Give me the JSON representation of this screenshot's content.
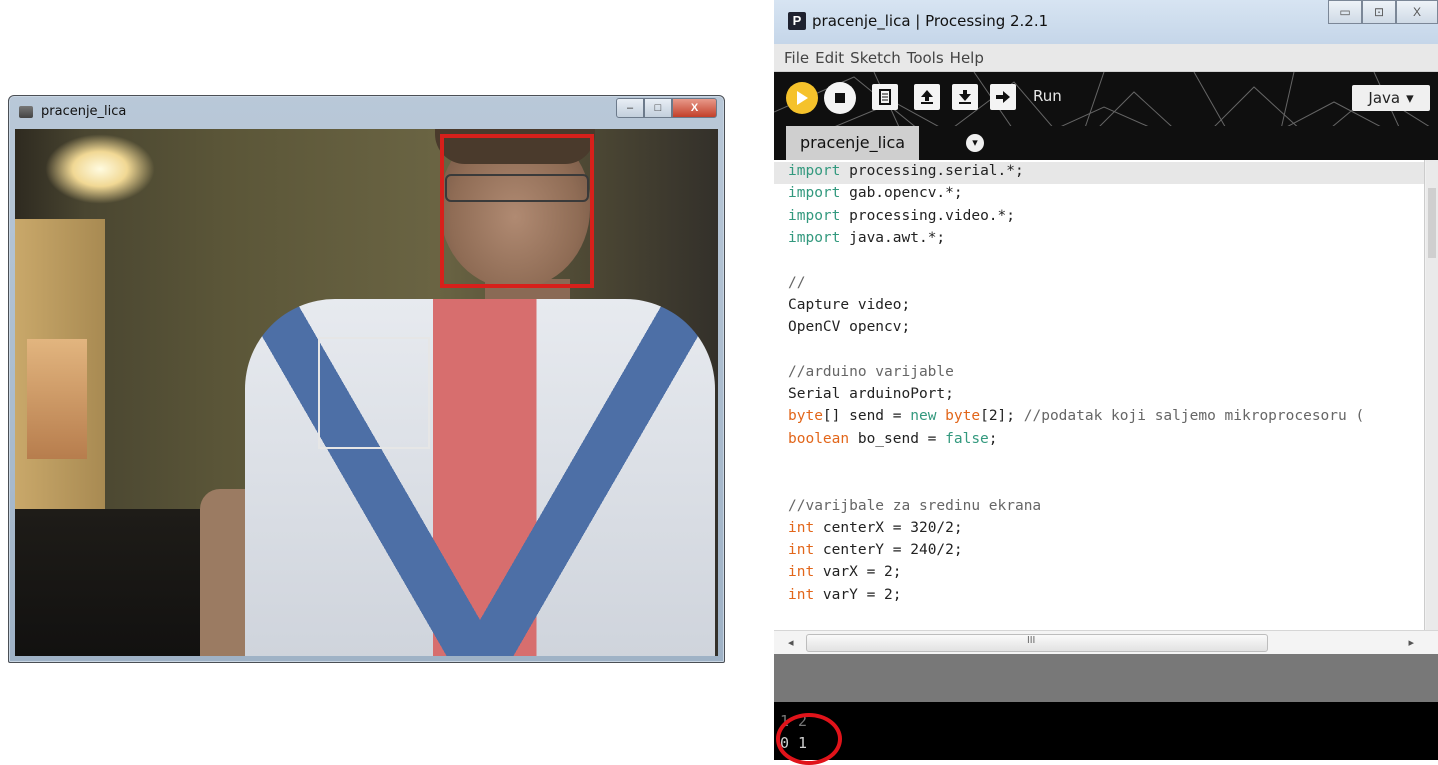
{
  "sketch_window": {
    "title": "pracenje_lica",
    "buttons": [
      "–",
      "□",
      "X"
    ]
  },
  "ide": {
    "title": "pracenje_lica | Processing 2.2.1",
    "logo_letter": "P",
    "window_buttons": [
      "▭",
      "⊡",
      "X"
    ],
    "menu": [
      "File",
      "Edit",
      "Sketch",
      "Tools",
      "Help"
    ],
    "toolbar": {
      "run_label": "Run",
      "mode": "Java"
    },
    "tab": "pracenje_lica",
    "code": [
      [
        {
          "t": "import",
          "c": "kw"
        },
        {
          "t": " processing.serial.*;",
          "c": ""
        }
      ],
      [
        {
          "t": "import",
          "c": "kw"
        },
        {
          "t": " gab.opencv.*;",
          "c": ""
        }
      ],
      [
        {
          "t": "import",
          "c": "kw"
        },
        {
          "t": " processing.video.*;",
          "c": ""
        }
      ],
      [
        {
          "t": "import",
          "c": "kw"
        },
        {
          "t": " java.awt.*;",
          "c": ""
        }
      ],
      [],
      [
        {
          "t": "//",
          "c": "cmt"
        }
      ],
      [
        {
          "t": "Capture video;",
          "c": ""
        }
      ],
      [
        {
          "t": "OpenCV opencv;",
          "c": ""
        }
      ],
      [],
      [
        {
          "t": "//arduino varijable",
          "c": "cmt"
        }
      ],
      [
        {
          "t": "Serial arduinoPort;",
          "c": ""
        }
      ],
      [
        {
          "t": "byte",
          "c": "type"
        },
        {
          "t": "[] send = ",
          "c": ""
        },
        {
          "t": "new",
          "c": "kw"
        },
        {
          "t": " ",
          "c": ""
        },
        {
          "t": "byte",
          "c": "type"
        },
        {
          "t": "[2]; ",
          "c": ""
        },
        {
          "t": "//podatak koji saljemo mikroprocesoru (",
          "c": "cmt"
        }
      ],
      [
        {
          "t": "boolean",
          "c": "type"
        },
        {
          "t": " bo_send = ",
          "c": ""
        },
        {
          "t": "false",
          "c": "kw"
        },
        {
          "t": ";",
          "c": ""
        }
      ],
      [],
      [],
      [
        {
          "t": "//varijbale za sredinu ekrana",
          "c": "cmt"
        }
      ],
      [
        {
          "t": "int",
          "c": "type"
        },
        {
          "t": " centerX = 320/2;",
          "c": ""
        }
      ],
      [
        {
          "t": "int",
          "c": "type"
        },
        {
          "t": " centerY = 240/2;",
          "c": ""
        }
      ],
      [
        {
          "t": "int",
          "c": "type"
        },
        {
          "t": " varX = 2;",
          "c": ""
        }
      ],
      [
        {
          "t": "int",
          "c": "type"
        },
        {
          "t": " varY = 2;",
          "c": ""
        }
      ]
    ],
    "hscroll_grip": "III",
    "console": [
      "1 2",
      "0 1"
    ]
  },
  "colors": {
    "face_box": "#d7201b",
    "track_box": "#e6e6e6",
    "run_button": "#f5c22b",
    "keyword": "#33997e",
    "type": "#e2661a",
    "highlight_circle": "#e0131a"
  }
}
